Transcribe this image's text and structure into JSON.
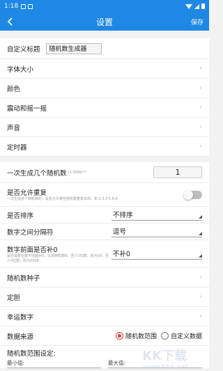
{
  "status": {
    "time": "1:18"
  },
  "appbar": {
    "title": "设置",
    "save_label": "保存"
  },
  "settings": {
    "custom_title_label": "自定义标题",
    "custom_title_value": "随机数生成器",
    "font_size": "字体大小",
    "color": "颜色",
    "vibrate": "震动和摇一摇",
    "sound": "声音",
    "timer": "定时器",
    "generate_count_label": "一次生成几个随机数",
    "generate_count_hint": "(1-9999)个",
    "generate_count_value": "1",
    "allow_repeat_label": "是否允许重复",
    "allow_repeat_desc": "一次生成多个随机数时，是否允许某些随机数重复出现，如 2,3,3,5,6,6",
    "allow_repeat_on": false,
    "sort_label": "是否排序",
    "sort_value": "不排序",
    "separator_label": "数字之间分隔符",
    "separator_value": "逗号",
    "pad_zero_label": "数字前面是否补0",
    "pad_zero_desc": "是否需要在数字前面补0，比如随机数8，至少2位数，则为08；至少4位数，则为0008",
    "pad_zero_value": "不补0",
    "seed": "随机数种子",
    "fixed": "定胆",
    "lucky": "幸运数字",
    "source_label": "数据来源",
    "source_opt1": "随机数范围",
    "source_opt2": "自定义数据",
    "range_label": "随机数范围设定:",
    "min_label": "最小值:",
    "max_label": "最大值:"
  },
  "watermark": {
    "text": "KK下载",
    "url": "www.kkx.net"
  }
}
